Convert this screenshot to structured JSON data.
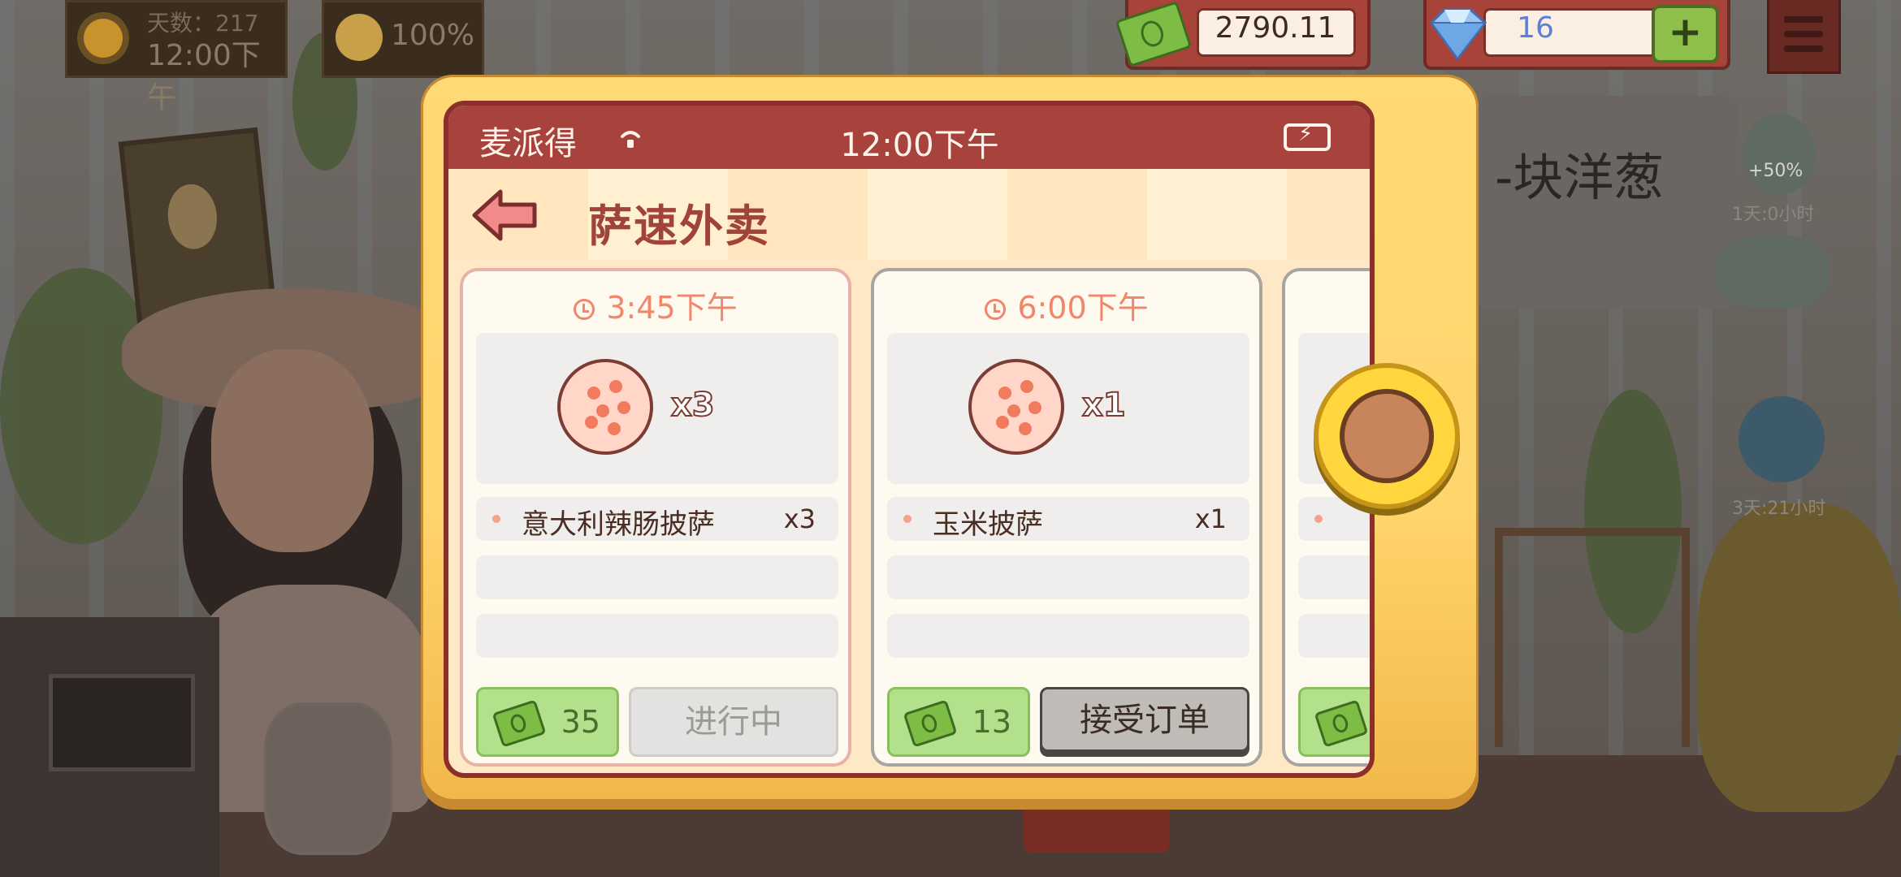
{
  "hud": {
    "day_label": "天数：217",
    "time": "12:00下午",
    "mood_percent": "100%",
    "money": "2790.11",
    "gems": "16",
    "add_label": "+",
    "board_text": "-块洋葱",
    "timer_1_bonus": "+50%",
    "timer_1": "1天:0小时",
    "timer_2": "3天:21小时"
  },
  "phone": {
    "carrier": "麦派得",
    "clock": "12:00下午",
    "app_title": "萨速外卖",
    "orders": [
      {
        "time": "3:45下午",
        "qty_badge": "x3",
        "item_name": "意大利辣肠披萨",
        "item_count": "x3",
        "pay": "35",
        "state": "进行中"
      },
      {
        "time": "6:00下午",
        "qty_badge": "x1",
        "item_name": "玉米披萨",
        "item_count": "x1",
        "pay": "13",
        "state": "接受订单"
      }
    ]
  },
  "colors": {
    "accent_red": "#a8423d",
    "title_red": "#a0443b",
    "modal_yellow": "#ffd56c",
    "pay_green": "#b3e08a",
    "time_orange": "#f0876b"
  },
  "icons": [
    "sun-icon",
    "smiley-icon",
    "cash-icon",
    "diamond-icon",
    "plus-icon",
    "menu-icon",
    "wifi-icon",
    "battery-icon",
    "back-arrow-icon",
    "clock-icon",
    "pizza-icon",
    "scroll-knob"
  ]
}
